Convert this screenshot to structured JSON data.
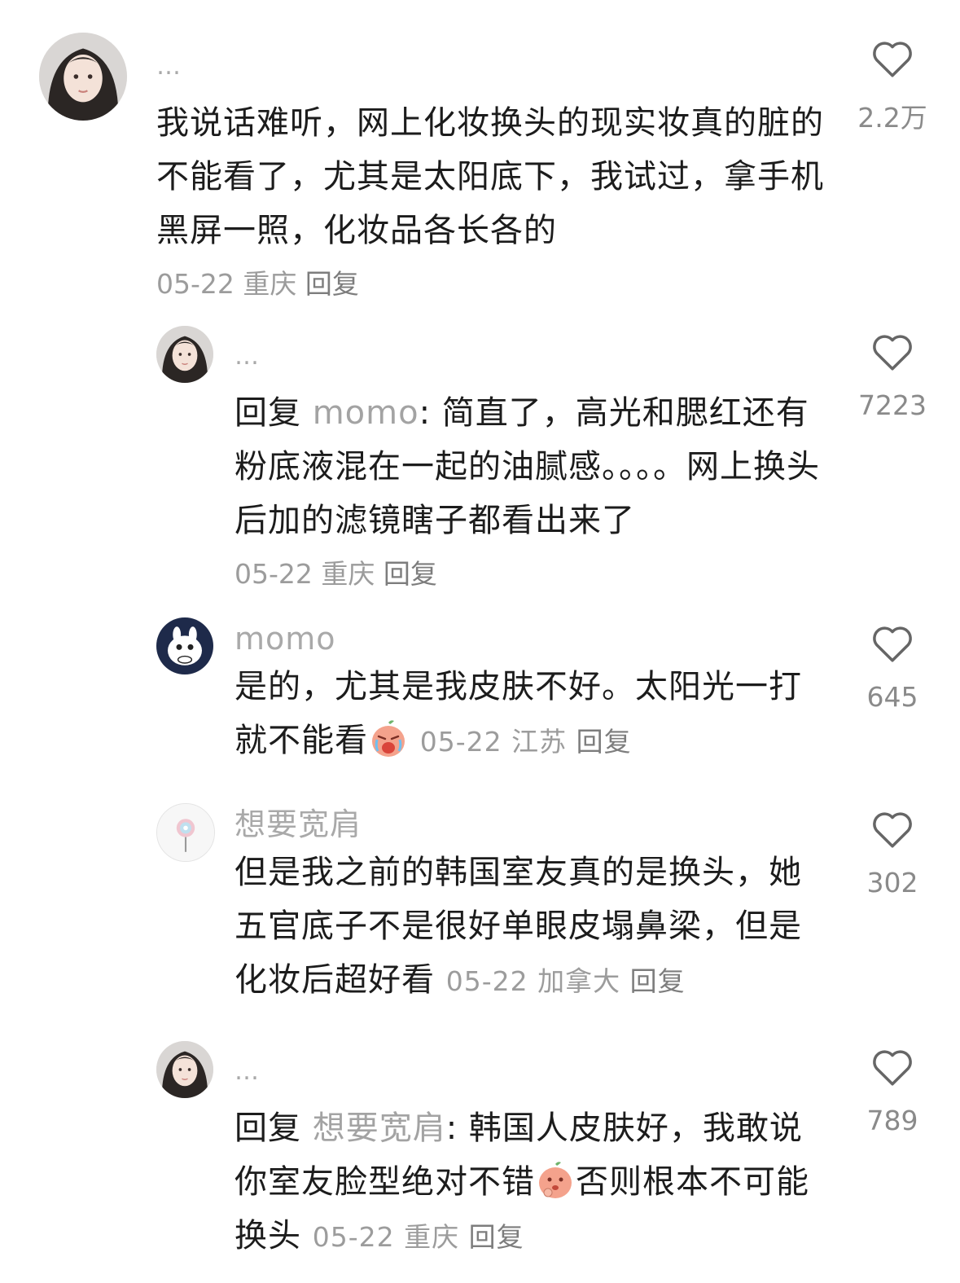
{
  "comments": [
    {
      "name": "…",
      "text": "我说话难听，网上化妆换头的现实妆真的脏的不能看了，尤其是太阳底下，我试过，拿手机黑屏一照，化妆品各长各的",
      "date": "05-22",
      "location": "重庆",
      "reply_label": "回复",
      "likes": "2.2万"
    },
    {
      "name": "…",
      "reply_prefix": "回复",
      "reply_to": "momo",
      "text": ": 简直了，高光和腮红还有粉底液混在一起的油腻感。。。。网上换头后加的滤镜瞎子都看出来了",
      "date": "05-22",
      "location": "重庆",
      "reply_label": "回复",
      "likes": "7223"
    },
    {
      "name": "momo",
      "text": "是的，尤其是我皮肤不好。太阳光一打就不能看",
      "emoji": "crying-peach-emoji",
      "date": "05-22",
      "location": "江苏",
      "reply_label": "回复",
      "likes": "645"
    },
    {
      "name": "想要宽肩",
      "text": "但是我之前的韩国室友真的是换头，她五官底子不是很好单眼皮塌鼻梁，但是化妆后超好看",
      "date": "05-22",
      "location": "加拿大",
      "reply_label": "回复",
      "likes": "302"
    },
    {
      "name": "…",
      "reply_prefix": "回复",
      "reply_to": "想要宽肩",
      "text_before_emoji": ": 韩国人皮肤好，我敢说你室友脸型绝对不错",
      "emoji": "thinking-peach-emoji",
      "text_after_emoji": "否则根本不可能换头",
      "date": "05-22",
      "location": "重庆",
      "reply_label": "回复",
      "likes": "789"
    }
  ],
  "colors": {
    "text": "#1c1c1c",
    "muted": "#a9a9a9",
    "icon": "#666666",
    "emoji_peach": "#f4a28c"
  }
}
